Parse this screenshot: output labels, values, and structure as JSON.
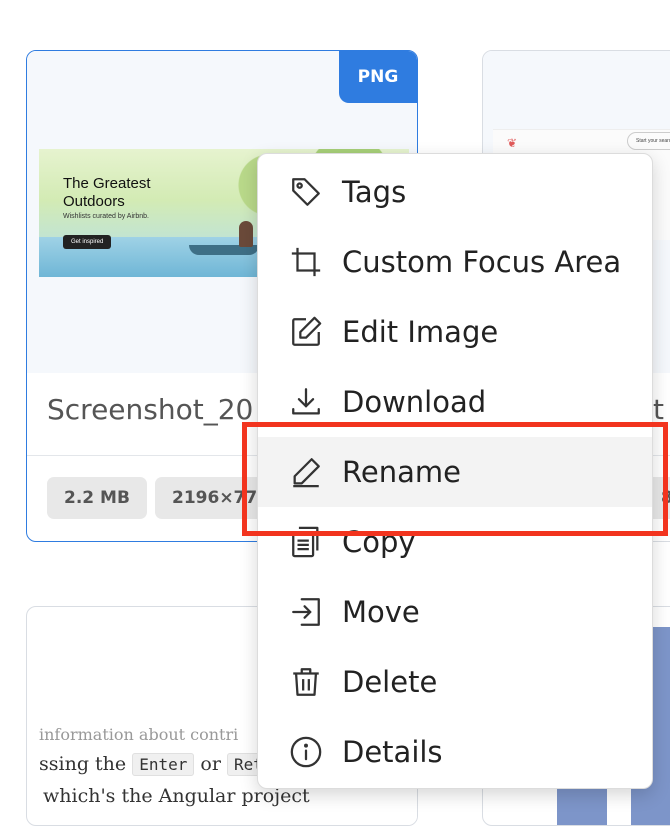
{
  "cards": [
    {
      "badge": "PNG",
      "thumbnail": {
        "title": "The Greatest\nOutdoors",
        "subtitle": "Wishlists curated by Airbnb.",
        "button": "Get inspired"
      },
      "file_name": "Screenshot_20",
      "chips": [
        "2.2 MB",
        "2196×774"
      ]
    },
    {
      "thumbnail": {
        "search": "Start your search"
      },
      "file_name": "t",
      "chip": "84"
    },
    {
      "doc_lines": [
        "information about contri",
        "ssing the",
        "Enter",
        "or",
        "Ret",
        "which's the Angular project"
      ]
    },
    {}
  ],
  "context_menu": {
    "items": [
      {
        "label": "Tags",
        "icon": "tag-icon"
      },
      {
        "label": "Custom Focus Area",
        "icon": "crop-icon"
      },
      {
        "label": "Edit Image",
        "icon": "edit-image-icon"
      },
      {
        "label": "Download",
        "icon": "download-icon"
      },
      {
        "label": "Rename",
        "icon": "pencil-icon",
        "hovered": true
      },
      {
        "label": "Copy",
        "icon": "copy-icon"
      },
      {
        "label": "Move",
        "icon": "move-icon"
      },
      {
        "label": "Delete",
        "icon": "trash-icon"
      },
      {
        "label": "Details",
        "icon": "info-icon"
      }
    ]
  },
  "colors": {
    "accent": "#2f7ce0",
    "highlight": "#f2341e",
    "hover_bg": "#f3f3f3"
  }
}
